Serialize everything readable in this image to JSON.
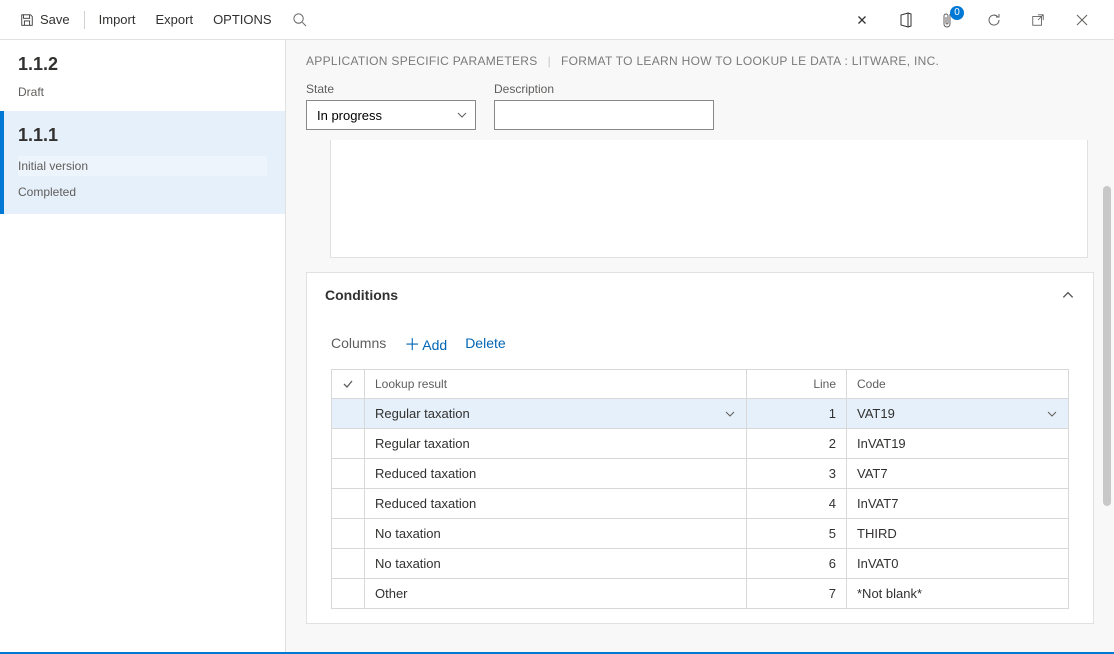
{
  "toolbar": {
    "save_label": "Save",
    "import_label": "Import",
    "export_label": "Export",
    "options_label": "OPTIONS",
    "docs_badge": "0"
  },
  "sidebar": {
    "versions": [
      {
        "title": "1.1.2",
        "status": "Draft",
        "sub1": "",
        "sub2": "",
        "selected": false
      },
      {
        "title": "1.1.1",
        "status": "",
        "sub1": "Initial version",
        "sub2": "Completed",
        "selected": true
      }
    ]
  },
  "breadcrumb": {
    "part1": "APPLICATION SPECIFIC PARAMETERS",
    "part2": "FORMAT TO LEARN HOW TO LOOKUP LE DATA : LITWARE, INC."
  },
  "form": {
    "state_label": "State",
    "state_value": "In progress",
    "description_label": "Description",
    "description_value": ""
  },
  "conditions": {
    "header": "Conditions",
    "toolbar": {
      "columns": "Columns",
      "add": "Add",
      "delete": "Delete"
    },
    "columns": {
      "lookup": "Lookup result",
      "line": "Line",
      "code": "Code"
    },
    "rows": [
      {
        "lookup": "Regular taxation",
        "line": "1",
        "code": "VAT19",
        "selected": true
      },
      {
        "lookup": "Regular taxation",
        "line": "2",
        "code": "InVAT19",
        "selected": false
      },
      {
        "lookup": "Reduced taxation",
        "line": "3",
        "code": "VAT7",
        "selected": false
      },
      {
        "lookup": "Reduced taxation",
        "line": "4",
        "code": "InVAT7",
        "selected": false
      },
      {
        "lookup": "No taxation",
        "line": "5",
        "code": "THIRD",
        "selected": false
      },
      {
        "lookup": "No taxation",
        "line": "6",
        "code": "InVAT0",
        "selected": false
      },
      {
        "lookup": "Other",
        "line": "7",
        "code": "*Not blank*",
        "selected": false
      }
    ]
  }
}
